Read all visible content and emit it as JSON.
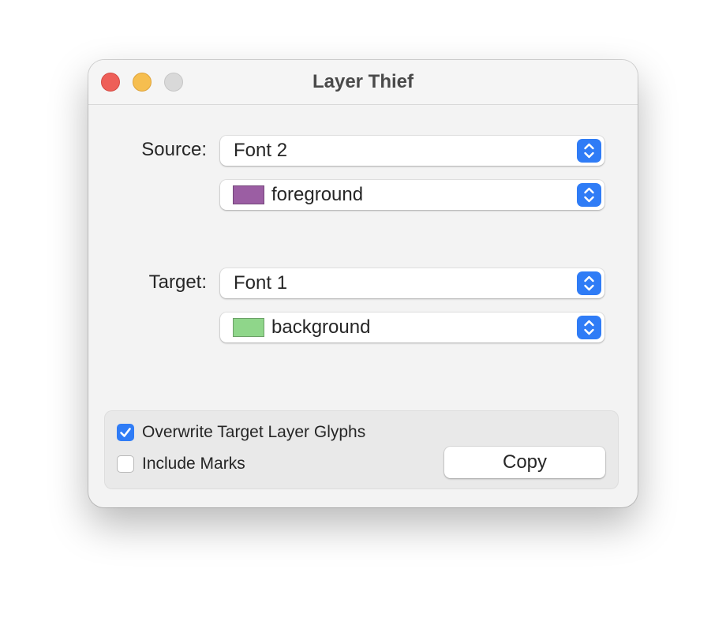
{
  "window": {
    "title": "Layer Thief"
  },
  "source": {
    "label": "Source:",
    "font_value": "Font 2",
    "layer_value": "foreground",
    "layer_color": "#9b5ea3"
  },
  "target": {
    "label": "Target:",
    "font_value": "Font 1",
    "layer_value": "background",
    "layer_color": "#8fd68a"
  },
  "options": {
    "overwrite_label": "Overwrite Target Layer Glyphs",
    "overwrite_checked": true,
    "include_marks_label": "Include Marks",
    "include_marks_checked": false
  },
  "actions": {
    "copy_label": "Copy"
  },
  "colors": {
    "accent": "#2f7cf6",
    "close": "#ee5f58",
    "minimize": "#f6be4f",
    "zoom": "#d9d9d9"
  }
}
